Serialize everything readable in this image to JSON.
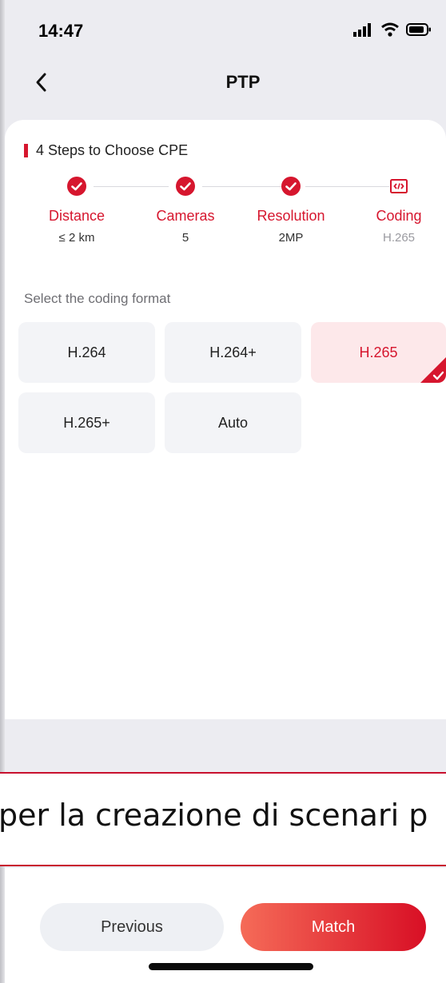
{
  "status_bar": {
    "time": "14:47"
  },
  "nav": {
    "title": "PTP"
  },
  "section": {
    "title": "4 Steps to Choose CPE"
  },
  "steps": [
    {
      "label": "Distance",
      "value": "≤ 2 km",
      "state": "done"
    },
    {
      "label": "Cameras",
      "value": "5",
      "state": "done"
    },
    {
      "label": "Resolution",
      "value": "2MP",
      "state": "done"
    },
    {
      "label": "Coding",
      "value": "H.265",
      "state": "current"
    }
  ],
  "format": {
    "prompt": "Select the coding format",
    "options": [
      "H.264",
      "H.264+",
      "H.265",
      "H.265+",
      "Auto"
    ],
    "selected": "H.265"
  },
  "overlay": {
    "text": "per la creazione di scenari p"
  },
  "actions": {
    "previous": "Previous",
    "match": "Match"
  },
  "colors": {
    "accent": "#d6162e",
    "selected_bg": "#fde8ea",
    "option_bg": "#f3f4f7"
  }
}
